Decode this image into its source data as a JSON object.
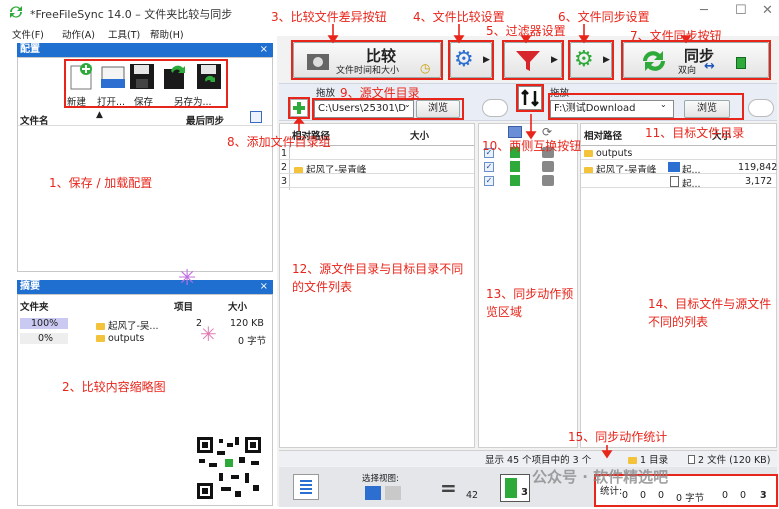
{
  "window": {
    "title": "*FreeFileSync 14.0 – 文件夹比较与同步",
    "controls": [
      "─",
      "☐",
      "✕"
    ]
  },
  "menu": [
    "文件(F)",
    "动作(A)",
    "工具(T)",
    "帮助(H)"
  ],
  "config_panel": {
    "title": "配置",
    "close": "×",
    "buttons": [
      "新建",
      "打开...",
      "保存",
      "另存为..."
    ],
    "col_name": "文件名",
    "col_last_sync": "最后同步"
  },
  "summary_panel": {
    "title": "摘要",
    "close": "×",
    "col_folder": "文件夹",
    "col_items": "项目",
    "col_size": "大小",
    "rows": [
      {
        "percent": "100%",
        "name": "起风了-吴...",
        "items": "2",
        "size": "120 KB",
        "fill": 1.0
      },
      {
        "percent": "0%",
        "name": "outputs",
        "items": "",
        "size": "0 字节",
        "fill": 0.0
      }
    ]
  },
  "toolbar": {
    "compare_label": "比较",
    "compare_sub": "文件时间和大小",
    "sync_label": "同步",
    "sync_sub": "双向"
  },
  "left_folder": {
    "drop_label": "拖放",
    "path": "C:\\Users\\25301\\D",
    "browse": "浏览"
  },
  "right_folder": {
    "drop_label": "拖放",
    "path": "F:\\测试Download",
    "browse": "浏览"
  },
  "left_grid": {
    "col_path": "相对路径",
    "col_size": "大小",
    "rows": [
      {
        "idx": "1",
        "name": ""
      },
      {
        "idx": "2",
        "name": "起风了-吴青峰"
      },
      {
        "idx": "3",
        "name": ""
      }
    ]
  },
  "right_grid": {
    "col_path": "相对路径",
    "col_size": "大小",
    "rows": [
      {
        "name": "outputs",
        "sub": "",
        "size": ""
      },
      {
        "name": "起风了-吴青峰",
        "sub": "起...",
        "size": "119,842"
      },
      {
        "name": "",
        "sub": "起...",
        "size": "3,172"
      }
    ]
  },
  "status": {
    "middle": "显示 45 个项目中的 3 个",
    "dirs": "1 目录",
    "files": "2 文件 (120 KB)"
  },
  "bottom": {
    "view_label": "选择视图:",
    "count_equal": "42",
    "count_sync": "3",
    "stats_label": "统计:",
    "stats": [
      "0",
      "0",
      "0",
      "0 字节",
      "0",
      "0",
      "3"
    ]
  },
  "watermark": "公众号 · 软件精选吧",
  "annotations": {
    "a1": "1、保存 / 加载配置",
    "a2": "2、比较内容缩略图",
    "a3": "3、比较文件差异按钮",
    "a4": "4、文件比较设置",
    "a5": "5、过滤器设置",
    "a6": "6、文件同步设置",
    "a7": "7、文件同步按钮",
    "a8": "8、添加文件目录组",
    "a9": "9、源文件目录",
    "a10": "10、两侧互换按钮",
    "a11": "11、目标文件目录",
    "a12": "12、源文件目录与目标目录不同的文件列表",
    "a13": "13、同步动作预览区域",
    "a14": "14、目标文件与源文件不同的列表",
    "a15": "15、同步动作统计"
  },
  "colors": {
    "accent_red": "#e8251b",
    "panel_blue": "#1f6fd1",
    "green": "#2eaa3a"
  }
}
